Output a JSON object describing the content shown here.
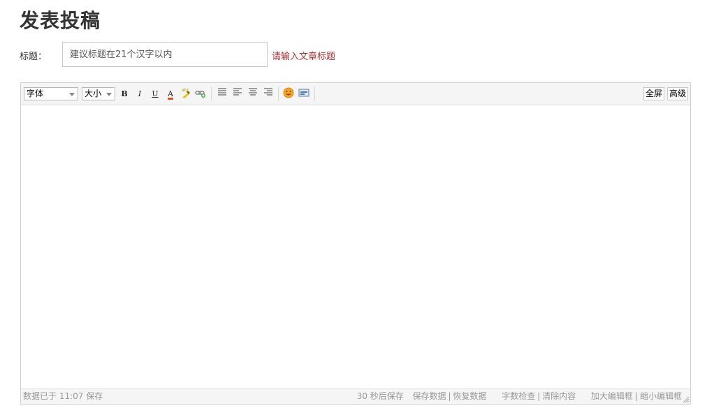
{
  "page": {
    "title": "发表投稿"
  },
  "form": {
    "title_label": "标题：",
    "title_placeholder": "建议标题在21个汉字以内",
    "title_value": "",
    "title_hint": "请输入文章标题"
  },
  "toolbar": {
    "font_select": "字体",
    "size_select": "大小",
    "bold_label": "B",
    "italic_label": "I",
    "underline_label": "U",
    "font_color_label": "A",
    "fullscreen_label": "全屏",
    "advanced_label": "高级",
    "icons": [
      "bold-icon",
      "italic-icon",
      "underline-icon",
      "font-color-icon",
      "highlight-icon",
      "link-icon",
      "justify-icon",
      "align-left-icon",
      "align-center-icon",
      "align-right-icon",
      "emoticon-icon",
      "image-icon"
    ]
  },
  "status": {
    "saved_text": "数据已于 11:07 保存",
    "autosave_text": "30 秒后保存",
    "save_data": "保存数据",
    "restore_data": "恢复数据",
    "word_check": "字数检查",
    "clear_content": "清除内容",
    "enlarge": "加大编辑框",
    "shrink": "缩小编辑框"
  },
  "colors": {
    "hint": "#aa3333",
    "toolbar_bg": "#f5f5f5",
    "border": "#d0d0d0"
  }
}
